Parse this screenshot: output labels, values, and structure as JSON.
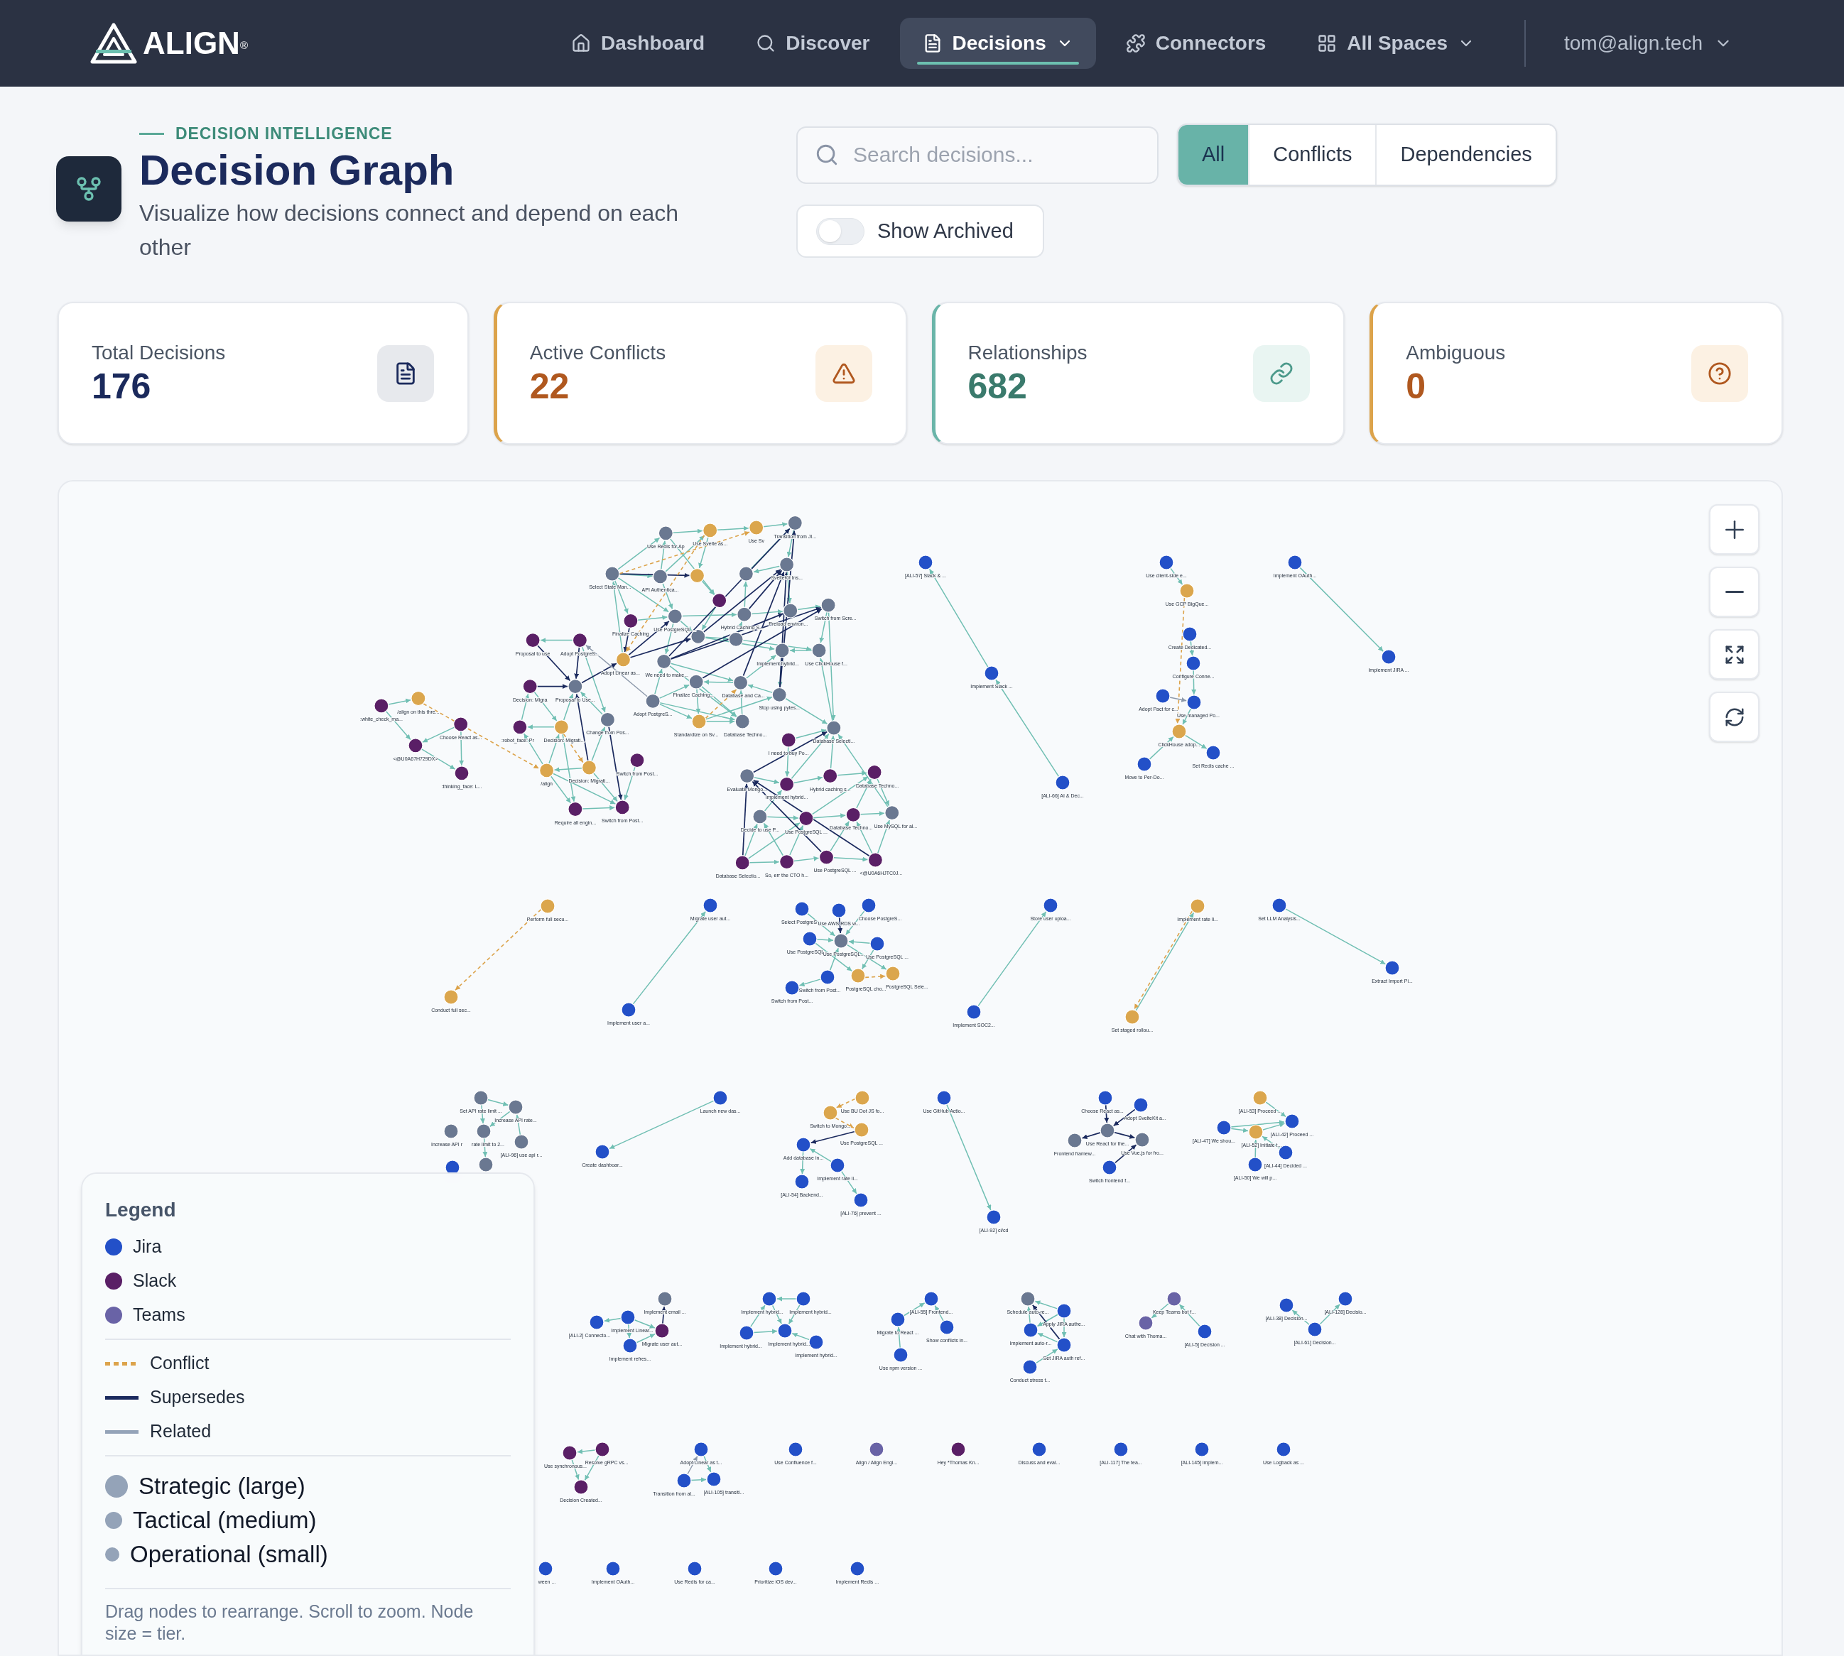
{
  "header": {
    "logo": "ALIGN$^{®}$",
    "nav": [
      {
        "label": "Dashboard",
        "selected": false,
        "dropdown": false
      },
      {
        "label": "Discover",
        "selected": false,
        "dropdown": false
      },
      {
        "label": "Decisions",
        "selected": true,
        "dropdown": true
      },
      {
        "label": "Connectors",
        "selected": false,
        "dropdown": false
      },
      {
        "label": "All Spaces",
        "selected": false,
        "dropdown": true
      }
    ],
    "user": {
      "email": "tom@align.tech"
    }
  },
  "page": {
    "eyebrow": "DECISION INTELLIGENCE",
    "title": "Decision Graph",
    "subtitle": "Visualize how decisions connect and depend on each other"
  },
  "search": {
    "placeholder": "Search decisions..."
  },
  "filters": [
    {
      "label": "All",
      "selected": true
    },
    {
      "label": "Conflicts",
      "selected": false
    },
    {
      "label": "Dependencies",
      "selected": false
    }
  ],
  "show_archived": {
    "label": "Show Archived",
    "on": false
  },
  "stats": [
    {
      "kind": "total",
      "label": "Total Decisions",
      "value": "176"
    },
    {
      "kind": "conflicts",
      "label": "Active Conflicts",
      "value": "22"
    },
    {
      "kind": "relationships",
      "label": "Relationships",
      "value": "682"
    },
    {
      "kind": "ambiguous",
      "label": "Ambiguous",
      "value": "0"
    }
  ],
  "graph": {
    "nodes": [
      {
        "label": "/align on this thre...",
        "color": "#dba64d"
      },
      {
        "label": ":white_check_ma...",
        "color": "#5a1f66"
      },
      {
        "label": "Choose React as...",
        "color": "#5a1f66"
      },
      {
        "label": "<@U0A67H729DX>",
        "color": "#5a1f66"
      },
      {
        "label": ":thinking_face: L...",
        "color": "#5a1f66"
      },
      {
        "label": "Use Redis for Ap",
        "color": "#6a7891"
      },
      {
        "label": "Use Svelte as...",
        "color": "#dba64d"
      },
      {
        "label": "Use Sv",
        "color": "#dba64d"
      },
      {
        "label": "Transition from JI...",
        "color": "#6a7891"
      },
      {
        "label": "Select State Man...",
        "color": "#6a7891"
      },
      {
        "label": "API Authentica...",
        "color": "#6a7891"
      },
      {
        "color": "#dba64d"
      },
      {
        "color": "#6a7891"
      },
      {
        "label": "SvelteKit Ins...",
        "color": "#6a7891"
      },
      {
        "label": "Finalize Caching",
        "color": "#5a1f66"
      },
      {
        "label": "Use PostgreSQL ...",
        "color": "#6a7891"
      },
      {
        "color": "#5a1f66"
      },
      {
        "label": "Hybrid Caching S...",
        "color": "#6a7891"
      },
      {
        "label": "Preload environ...",
        "color": "#6a7891"
      },
      {
        "label": "Switch from Scre...",
        "color": "#6a7891"
      },
      {
        "color": "#6a7891"
      },
      {
        "color": "#6a7891"
      },
      {
        "label": "Adopt Linear as...",
        "color": "#dba64d"
      },
      {
        "label": "We need to make...",
        "color": "#6a7891"
      },
      {
        "label": "Implement hybrid...",
        "color": "#6a7891"
      },
      {
        "label": "Use ClickHouse f...",
        "color": "#6a7891"
      },
      {
        "label": "Finalize Caching...",
        "color": "#6a7891"
      },
      {
        "label": "Database and Ca...",
        "color": "#6a7891"
      },
      {
        "label": "Stop using pytes...",
        "color": "#6a7891"
      },
      {
        "label": "Standardize on Sv...",
        "color": "#dba64d"
      },
      {
        "label": "Database Techno...",
        "color": "#6a7891"
      },
      {
        "label": "I need to buy Po...",
        "color": "#5a1f66"
      },
      {
        "label": "Database Selecti...",
        "color": "#6a7891"
      },
      {
        "label": "Evaluate Mongo...",
        "color": "#6a7891"
      },
      {
        "label": "Implement hybrid...",
        "color": "#5a1f66"
      },
      {
        "label": "Hybrid caching s...",
        "color": "#5a1f66"
      },
      {
        "label": "Database Techno...",
        "color": "#5a1f66"
      },
      {
        "label": "Decide to use P...",
        "color": "#6a7891"
      },
      {
        "label": "Use PostgreSQL ...",
        "color": "#5a1f66"
      },
      {
        "label": "Database Techno...",
        "color": "#5a1f66"
      },
      {
        "label": "Use MySQL for al...",
        "color": "#6a7891"
      },
      {
        "label": "Database Selectio...",
        "color": "#5a1f66"
      },
      {
        "label": "So, err the CTO h...",
        "color": "#5a1f66"
      },
      {
        "label": "Use PostgreSQL ...",
        "color": "#5a1f66"
      },
      {
        "label": "<@U0A6HJTC0J...",
        "color": "#5a1f66"
      },
      {
        "label": "Proposal to use",
        "color": "#5a1f66"
      },
      {
        "label": "Adopt PostgreS...",
        "color": "#5a1f66"
      },
      {
        "label": "Decision: Migra",
        "color": "#5a1f66"
      },
      {
        "label": "Proposal to Use...",
        "color": "#6a7891"
      },
      {
        "label": "Adopt PostgreS...",
        "color": "#6a7891"
      },
      {
        "label": ":robot_face: Pr",
        "color": "#5a1f66"
      },
      {
        "label": "Decision: Migrati...",
        "color": "#dba64d"
      },
      {
        "label": "Change from Pos...",
        "color": "#6a7891"
      },
      {
        "label": "/align",
        "color": "#dba64d"
      },
      {
        "label": "Decision: Migrati...",
        "color": "#dba64d"
      },
      {
        "label": "Switch from Post...",
        "color": "#5a1f66"
      },
      {
        "label": "Require all engin...",
        "color": "#5a1f66"
      },
      {
        "label": "Switch from Post...",
        "color": "#5a1f66"
      },
      {
        "label": "[ALI-57] Slack & ...",
        "color": "#2350c8"
      },
      {
        "label": "Implement Slack ...",
        "color": "#2350c8"
      },
      {
        "label": "[ALI-66] AI & Dec...",
        "color": "#2350c8"
      },
      {
        "label": "Use client-side e...",
        "color": "#2350c8"
      },
      {
        "label": "Use GCP BigQue...",
        "color": "#dba64d"
      },
      {
        "label": "Create Dedicated...",
        "color": "#2350c8"
      },
      {
        "label": "Configure Conne...",
        "color": "#2350c8"
      },
      {
        "label": "Adopt Pact for c...",
        "color": "#2350c8"
      },
      {
        "label": "Use managed Po...",
        "color": "#2350c8"
      },
      {
        "label": "ClickHouse adop...",
        "color": "#dba64d"
      },
      {
        "label": "Set Redis cache ...",
        "color": "#2350c8"
      },
      {
        "label": "Move to Per-Do...",
        "color": "#2350c8"
      },
      {
        "label": "Implement OAuth...",
        "color": "#2350c8"
      },
      {
        "label": "Implement JIRA ...",
        "color": "#2350c8"
      },
      {
        "label": "Perform full secu...",
        "color": "#dba64d"
      },
      {
        "label": "Conduct full sec...",
        "color": "#dba64d"
      },
      {
        "label": "Migrate user aut...",
        "color": "#2350c8"
      },
      {
        "label": "Implement user a...",
        "color": "#2350c8"
      },
      {
        "label": "Select PostgreS",
        "color": "#2350c8"
      },
      {
        "label": "Use AWS RDS w...",
        "color": "#2350c8"
      },
      {
        "label": "Choose PostgreS...",
        "color": "#2350c8"
      },
      {
        "label": "Use PostgreSQL",
        "color": "#2350c8"
      },
      {
        "label": "Use PostgreSQL...",
        "color": "#6a7891"
      },
      {
        "label": "Use PostgreSQL ...",
        "color": "#2350c8"
      },
      {
        "label": "Switch from Post...",
        "color": "#2350c8"
      },
      {
        "label": "Switch from Post...",
        "color": "#2350c8"
      },
      {
        "label": "PostgreSQL cho...",
        "color": "#dba64d"
      },
      {
        "label": "PostgreSQL Sele...",
        "color": "#dba64d"
      },
      {
        "label": "Store user uploa...",
        "color": "#2350c8"
      },
      {
        "label": "Implement SOC2...",
        "color": "#2350c8"
      },
      {
        "label": "Implement rate li...",
        "color": "#dba64d"
      },
      {
        "label": "Set staged rollou...",
        "color": "#dba64d"
      },
      {
        "label": "Set LLM Analysis...",
        "color": "#2350c8"
      },
      {
        "label": "Extract Import Pi...",
        "color": "#2350c8"
      },
      {
        "label": "Set API rate limit ...",
        "color": "#6a7891"
      },
      {
        "label": "Increase API rate...",
        "color": "#6a7891"
      },
      {
        "label": "Increase API r",
        "color": "#6a7891"
      },
      {
        "label": "rate limit to 2...",
        "color": "#6a7891"
      },
      {
        "label": "[ALI-96] use api r...",
        "color": "#6a7891"
      },
      {
        "color": "#2350c8"
      },
      {
        "color": "#6a7891"
      },
      {
        "label": "Launch new das...",
        "color": "#2350c8"
      },
      {
        "label": "Create dashboar...",
        "color": "#2350c8"
      },
      {
        "label": "Use BU Dot JS fo...",
        "color": "#dba64d"
      },
      {
        "label": "Switch to Mongo...",
        "color": "#dba64d"
      },
      {
        "label": "Use PostgreSQL ...",
        "color": "#dba64d"
      },
      {
        "label": "Add database in...",
        "color": "#2350c8"
      },
      {
        "label": "Implement rate li...",
        "color": "#2350c8"
      },
      {
        "label": "[ALI-54] Backend...",
        "color": "#2350c8"
      },
      {
        "label": "[ALI-76] prevent ...",
        "color": "#2350c8"
      },
      {
        "label": "Use GitHub Actio...",
        "color": "#2350c8"
      },
      {
        "label": "[ALI-92] ci/cd",
        "color": "#2350c8"
      },
      {
        "label": "Choose React as...",
        "color": "#2350c8"
      },
      {
        "label": "Adopt SvelteKit a...",
        "color": "#2350c8"
      },
      {
        "label": "Use React for the...",
        "color": "#6a7891"
      },
      {
        "label": "Frontend framew...",
        "color": "#6a7891"
      },
      {
        "label": "Use Vue.js for fro...",
        "color": "#6a7891"
      },
      {
        "label": "Switch frontend f...",
        "color": "#2350c8"
      },
      {
        "label": "[ALI-53] Proceed ...",
        "color": "#dba64d"
      },
      {
        "label": "[ALI-42] Proceed ...",
        "color": "#2350c8"
      },
      {
        "label": "[ALI-47] We shou...",
        "color": "#2350c8"
      },
      {
        "label": "[ALI-52] Initiate t...",
        "color": "#dba64d"
      },
      {
        "label": "[ALI-44] Decided ...",
        "color": "#2350c8"
      },
      {
        "label": "[ALI-50] We will p...",
        "color": "#2350c8"
      },
      {
        "label": "Implement email ...",
        "color": "#6a7891"
      },
      {
        "label": "[ALI-2] Connecto...",
        "color": "#2350c8"
      },
      {
        "label": "Implement Linear...",
        "color": "#2350c8"
      },
      {
        "label": "Migrate user aut...",
        "color": "#5a1f66"
      },
      {
        "label": "Implement refres...",
        "color": "#2350c8"
      },
      {
        "label": "Implement hybrid...",
        "color": "#2350c8"
      },
      {
        "label": "Implement hybrid...",
        "color": "#2350c8"
      },
      {
        "label": "Implement hybrid...",
        "color": "#2350c8"
      },
      {
        "label": "Implement hybrid...",
        "color": "#2350c8"
      },
      {
        "label": "Implement hybrid...",
        "color": "#2350c8"
      },
      {
        "label": "[ALI-55] Frontend...",
        "color": "#2350c8"
      },
      {
        "label": "Migrate to React ...",
        "color": "#2350c8"
      },
      {
        "label": "Show conflicts in...",
        "color": "#2350c8"
      },
      {
        "label": "Use npm version ...",
        "color": "#2350c8"
      },
      {
        "label": "Schedule auto-re...",
        "color": "#6a7891"
      },
      {
        "label": "Apply JIRA authe...",
        "color": "#2350c8"
      },
      {
        "label": "Implement auto-r...",
        "color": "#2350c8"
      },
      {
        "label": "Set JIRA auth ref...",
        "color": "#2350c8"
      },
      {
        "label": "Conduct stress t...",
        "color": "#2350c8"
      },
      {
        "label": "Keep Teams bot f...",
        "color": "#6963a6"
      },
      {
        "label": "Chat with Thoma...",
        "color": "#6963a6"
      },
      {
        "label": "[ALI-5] Decision ...",
        "color": "#2350c8"
      },
      {
        "label": "[ALI-38] Decision...",
        "color": "#2350c8"
      },
      {
        "label": "[ALI-128] Decisio...",
        "color": "#2350c8"
      },
      {
        "label": "[ALI-61] Decision...",
        "color": "#2350c8"
      },
      {
        "label": "Use synchronous...",
        "color": "#5a1f66"
      },
      {
        "label": "Resolve gRPC vs...",
        "color": "#5a1f66"
      },
      {
        "label": "Decision Created...",
        "color": "#5a1f66"
      },
      {
        "label": "Adopt Linear as t...",
        "color": "#2350c8"
      },
      {
        "label": "Transition from al...",
        "color": "#2350c8"
      },
      {
        "label": "[ALI-105] transiti...",
        "color": "#2350c8"
      },
      {
        "label": "Use Confluence f...",
        "color": "#2350c8"
      },
      {
        "label": "Align / Align Engi...",
        "color": "#6963a6"
      },
      {
        "label": "Hey *Thomas Kn...",
        "color": "#5a1f66"
      },
      {
        "label": "Discuss and eval...",
        "color": "#2350c8"
      },
      {
        "label": "[ALI-117] The tea...",
        "color": "#2350c8"
      },
      {
        "label": "[ALI-145] implem...",
        "color": "#2350c8"
      },
      {
        "label": "Use Logback as ...",
        "color": "#2350c8"
      },
      {
        "label": "ween ...",
        "color": "#2350c8"
      },
      {
        "label": "Implement OAuth...",
        "color": "#2350c8"
      },
      {
        "label": "Use Redis for ca...",
        "color": "#2350c8"
      },
      {
        "label": "Prioritize iOS dev...",
        "color": "#2350c8"
      },
      {
        "label": "Implement Redis ...",
        "color": "#2350c8"
      }
    ],
    "edges": [
      {
        "kind": "depends"
      },
      {
        "kind": "supersedes"
      },
      {
        "kind": "conflict"
      },
      {
        "kind": "related"
      }
    ]
  },
  "legend": {
    "title": "Legend",
    "sources": [
      {
        "label": "Jira",
        "color": "#2350c8"
      },
      {
        "label": "Slack",
        "color": "#5a1f66"
      },
      {
        "label": "Teams",
        "color": "#6963a6"
      }
    ],
    "edge_types": [
      {
        "label": "Conflict",
        "kind": "conflict"
      },
      {
        "label": "Supersedes",
        "kind": "supersedes"
      },
      {
        "label": "Related",
        "kind": "related"
      }
    ],
    "tiers": [
      {
        "label": "Strategic (large)",
        "kind": "large"
      },
      {
        "label": "Tactical (medium)",
        "kind": "medium"
      },
      {
        "label": "Operational (small)",
        "kind": "small"
      }
    ],
    "hint": "Drag nodes to rearrange. Scroll to zoom. Node size = tier."
  }
}
